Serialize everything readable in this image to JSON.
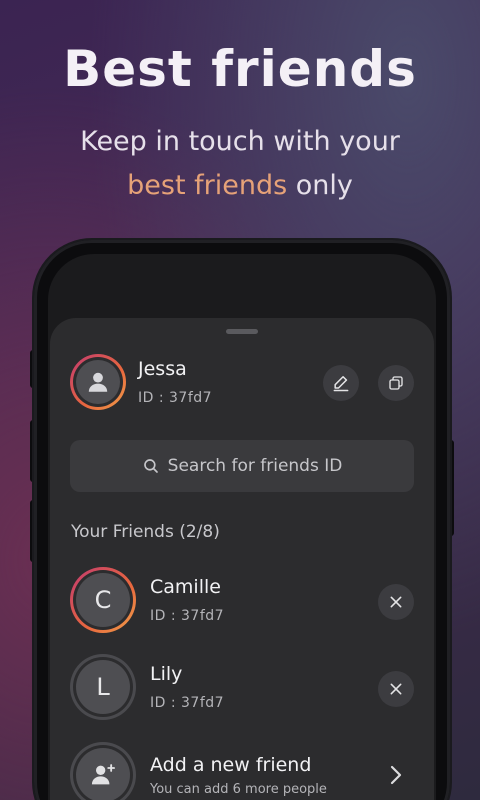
{
  "hero": {
    "title": "Best friends",
    "subtitle_line1": "Keep in touch with your",
    "subtitle_accent": "best friends",
    "subtitle_end": " only"
  },
  "profile": {
    "name": "Jessa",
    "id": "ID : 37fd7"
  },
  "search": {
    "placeholder": "Search for friends ID"
  },
  "friends": {
    "section_title": "Your Friends (2/8)",
    "items": [
      {
        "initial": "C",
        "name": "Camille",
        "id": "ID : 37fd7"
      },
      {
        "initial": "L",
        "name": "Lily",
        "id": "ID : 37fd7"
      }
    ],
    "add": {
      "title": "Add a new friend",
      "subtitle": "You can add 6 more people"
    }
  },
  "colors": {
    "accent": "#e6a278",
    "ring_start": "#c23a70",
    "ring_end": "#f0a04a",
    "sheet": "#2c2c2e"
  },
  "icons": [
    "person-icon",
    "edit-icon",
    "copy-icon",
    "search-icon",
    "close-icon",
    "add-person-icon",
    "chevron-right-icon"
  ]
}
